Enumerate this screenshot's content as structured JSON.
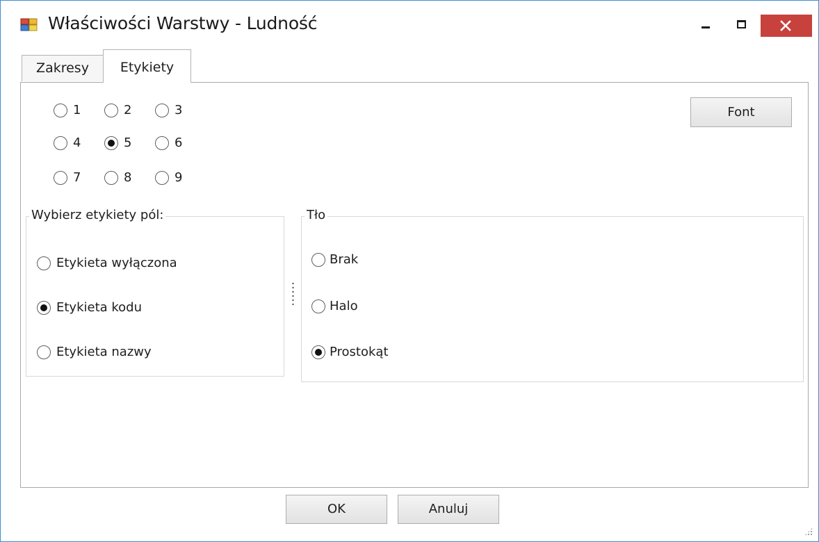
{
  "window": {
    "title": "Właściwości Warstwy - Ludność"
  },
  "tabs": [
    {
      "label": "Zakresy",
      "active": false
    },
    {
      "label": "Etykiety",
      "active": true
    }
  ],
  "positions": {
    "options": [
      "1",
      "2",
      "3",
      "4",
      "5",
      "6",
      "7",
      "8",
      "9"
    ],
    "selected": "5"
  },
  "font_button": {
    "label": "Font"
  },
  "field_labels": {
    "title": "Wybierz etykiety pól:",
    "options": [
      "Etykieta wyłączona",
      "Etykieta kodu",
      "Etykieta nazwy"
    ],
    "selected": "Etykieta kodu"
  },
  "background": {
    "title": "Tło",
    "options": [
      "Brak",
      "Halo",
      "Prostokąt"
    ],
    "selected": "Prostokąt"
  },
  "buttons": {
    "ok": "OK",
    "cancel": "Anuluj"
  },
  "icons": {
    "app": "layer-properties-icon",
    "minimize": "minimize-icon",
    "maximize": "maximize-icon",
    "close": "close-icon"
  },
  "colors": {
    "window_border": "#3c8fd1",
    "close_button": "#c7413d"
  }
}
